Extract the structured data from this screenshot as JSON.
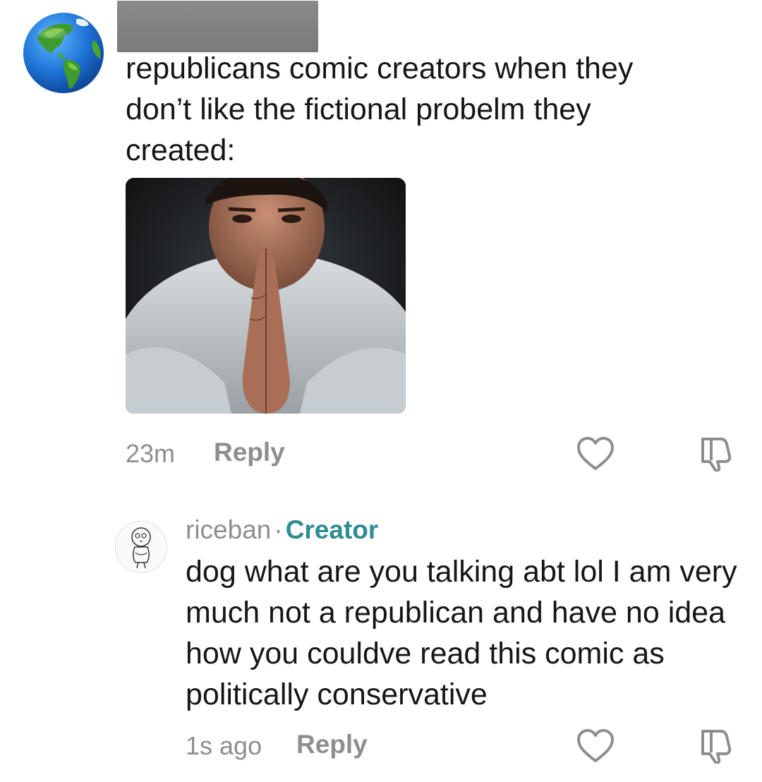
{
  "comments": [
    {
      "avatar_icon": "globe-earth-icon",
      "text": "republicans comic creators when they don’t like the fictional probelm they created:",
      "time": "23m",
      "reply_label": "Reply",
      "like_icon": "heart-outline-icon",
      "dislike_icon": "thumbs-down-icon"
    },
    {
      "avatar_icon": "sketch-character-avatar",
      "username": "riceban",
      "separator": "·",
      "badge": "Creator",
      "text": "dog what are you talking abt lol I am very much not a republican and have no idea how you couldve read this comic as politically conservative",
      "time": "1s ago",
      "reply_label": "Reply",
      "like_icon": "heart-outline-icon",
      "dislike_icon": "thumbs-down-icon"
    }
  ],
  "colors": {
    "meta_gray": "#8e8e8e",
    "creator_teal": "#2f8c92",
    "text_dark": "#161616"
  }
}
